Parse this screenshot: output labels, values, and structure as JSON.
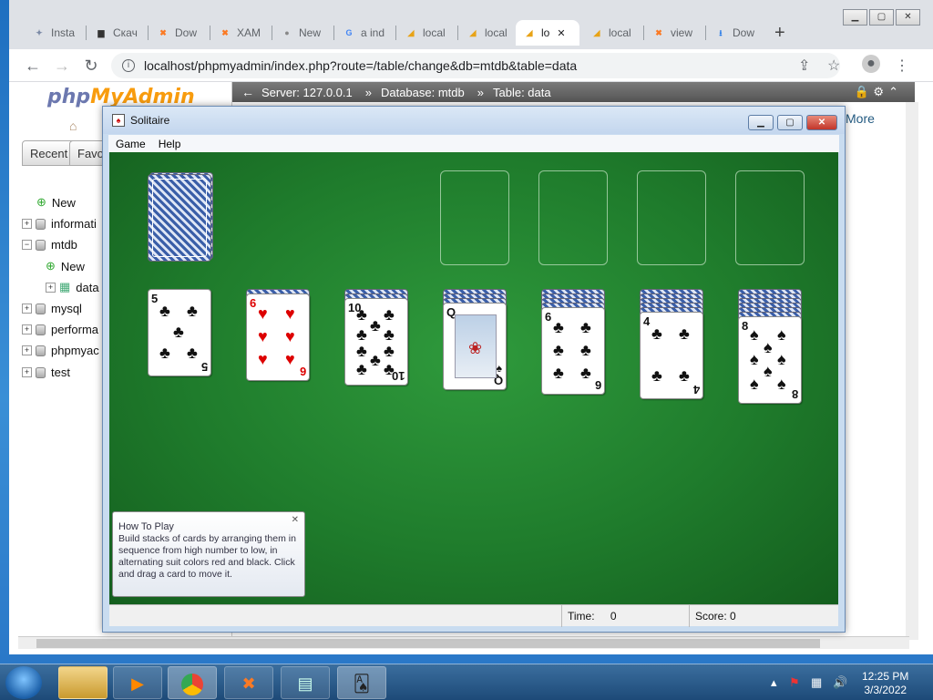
{
  "browser": {
    "tabs": [
      {
        "label": "Insta",
        "icon": "sparkle-icon"
      },
      {
        "label": "Скач",
        "icon": "monitor-icon"
      },
      {
        "label": "Dow",
        "icon": "xampp-icon"
      },
      {
        "label": "XAM",
        "icon": "xampp-icon"
      },
      {
        "label": "New",
        "icon": "chrome-icon"
      },
      {
        "label": "a ind",
        "icon": "google-icon"
      },
      {
        "label": "local",
        "icon": "pma-icon"
      },
      {
        "label": "local",
        "icon": "pma-icon"
      },
      {
        "label": "lo",
        "icon": "pma-icon"
      },
      {
        "label": "local",
        "icon": "pma-icon"
      },
      {
        "label": "view",
        "icon": "xampp-icon"
      },
      {
        "label": "Dow",
        "icon": "download-icon"
      }
    ],
    "active_tab_index": 8,
    "url": "localhost/phpmyadmin/index.php?route=/table/change&db=mtdb&table=data"
  },
  "pma": {
    "logo_php": "php",
    "logo_myadmin": "MyAdmin",
    "tabs": [
      "Recent",
      "Favo"
    ],
    "tree": [
      {
        "label": "New",
        "level": 1,
        "type": "new"
      },
      {
        "label": "informati",
        "level": 0,
        "type": "db"
      },
      {
        "label": "mtdb",
        "level": 0,
        "type": "db"
      },
      {
        "label": "New",
        "level": 2,
        "type": "new"
      },
      {
        "label": "data",
        "level": 2,
        "type": "table"
      },
      {
        "label": "mysql",
        "level": 0,
        "type": "db"
      },
      {
        "label": "performa",
        "level": 0,
        "type": "db"
      },
      {
        "label": "phpmyac",
        "level": 0,
        "type": "db"
      },
      {
        "label": "test",
        "level": 0,
        "type": "db"
      }
    ],
    "breadcrumb": {
      "server": "Server: 127.0.0.1",
      "database": "Database: mtdb",
      "table": "Table: data"
    },
    "more_label": "More"
  },
  "solitaire": {
    "title": "Solitaire",
    "menu": [
      "Game",
      "Help"
    ],
    "status": {
      "time_label": "Time:",
      "time_value": "0",
      "score_label": "Score:",
      "score_value": "0"
    },
    "tableau": [
      {
        "hidden": 0,
        "face": {
          "rank": "5",
          "suit": "♣",
          "color": "black"
        }
      },
      {
        "hidden": 1,
        "face": {
          "rank": "6",
          "suit": "♥",
          "color": "red"
        }
      },
      {
        "hidden": 2,
        "face": {
          "rank": "10",
          "suit": "♣",
          "color": "black"
        }
      },
      {
        "hidden": 3,
        "face": {
          "rank": "Q",
          "suit": "♠",
          "color": "black"
        }
      },
      {
        "hidden": 4,
        "face": {
          "rank": "6",
          "suit": "♣",
          "color": "black"
        }
      },
      {
        "hidden": 5,
        "face": {
          "rank": "4",
          "suit": "♣",
          "color": "black"
        }
      },
      {
        "hidden": 6,
        "face": {
          "rank": "8",
          "suit": "♠",
          "color": "black"
        }
      }
    ],
    "howto": {
      "title": "How To Play",
      "text": "Build stacks of cards by arranging them in sequence from high number to low, in alternating suit colors red and black. Click and drag a card to move it."
    }
  },
  "taskbar": {
    "time": "12:25 PM",
    "date": "3/3/2022"
  }
}
